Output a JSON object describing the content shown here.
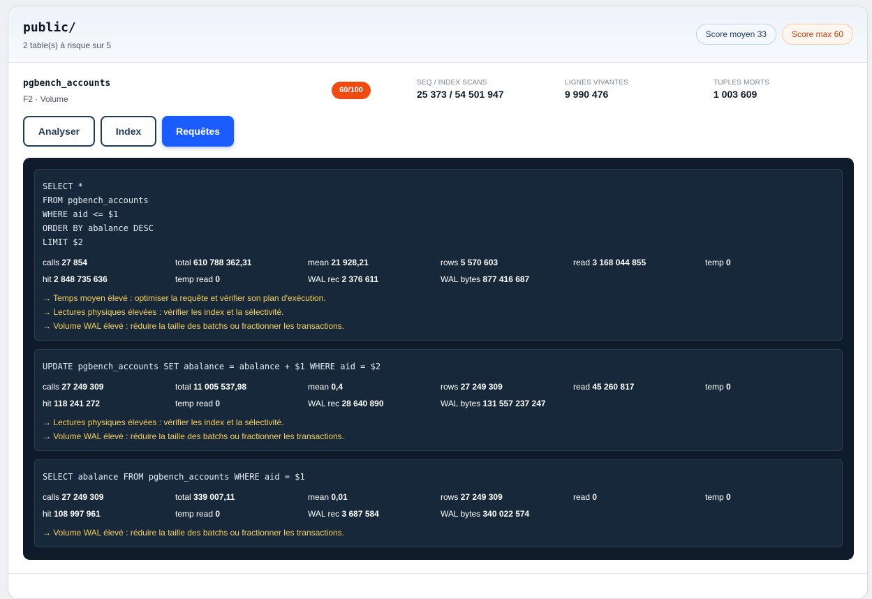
{
  "schema": {
    "title": "public/",
    "subtitle": "2 table(s) à risque sur 5"
  },
  "pills": {
    "avg": "Score moyen 33",
    "max": "Score max 60"
  },
  "table": {
    "name": "pgbench_accounts",
    "subtitle": "F2 · Volume",
    "score": "60/100",
    "stats": [
      {
        "label": "SEQ / INDEX SCANS",
        "value": "25 373 / 54 501 947"
      },
      {
        "label": "LIGNES VIVANTES",
        "value": "9 990 476"
      },
      {
        "label": "TUPLES MORTS",
        "value": "1 003 609"
      }
    ]
  },
  "buttons": {
    "analyze": "Analyser",
    "index": "Index",
    "queries": "Requêtes"
  },
  "queries": [
    {
      "sql": "SELECT *\nFROM pgbench_accounts\nWHERE aid <= $1\nORDER BY abalance DESC\nLIMIT $2",
      "metrics": [
        {
          "label": "calls",
          "value": "27 854"
        },
        {
          "label": "total",
          "value": "610 788 362,31"
        },
        {
          "label": "mean",
          "value": "21 928,21"
        },
        {
          "label": "rows",
          "value": "5 570 603"
        },
        {
          "label": "read",
          "value": "3 168 044 855"
        },
        {
          "label": "temp",
          "value": "0"
        },
        {
          "label": "hit",
          "value": "2 848 735 636"
        },
        {
          "label": "temp read",
          "value": "0"
        },
        {
          "label": "WAL rec",
          "value": "2 376 611"
        },
        {
          "label": "WAL bytes",
          "value": "877 416 687"
        }
      ],
      "hints": [
        "→ Temps moyen élevé : optimiser la requête et vérifier son plan d'exécution.",
        "→ Lectures physiques élevées : vérifier les index et la sélectivité.",
        "→ Volume WAL élevé : réduire la taille des batchs ou fractionner les transactions."
      ]
    },
    {
      "sql": "UPDATE pgbench_accounts SET abalance = abalance + $1 WHERE aid = $2",
      "metrics": [
        {
          "label": "calls",
          "value": "27 249 309"
        },
        {
          "label": "total",
          "value": "11 005 537,98"
        },
        {
          "label": "mean",
          "value": "0,4"
        },
        {
          "label": "rows",
          "value": "27 249 309"
        },
        {
          "label": "read",
          "value": "45 260 817"
        },
        {
          "label": "temp",
          "value": "0"
        },
        {
          "label": "hit",
          "value": "118 241 272"
        },
        {
          "label": "temp read",
          "value": "0"
        },
        {
          "label": "WAL rec",
          "value": "28 640 890"
        },
        {
          "label": "WAL bytes",
          "value": "131 557 237 247"
        }
      ],
      "hints": [
        "→ Lectures physiques élevées : vérifier les index et la sélectivité.",
        "→ Volume WAL élevé : réduire la taille des batchs ou fractionner les transactions."
      ]
    },
    {
      "sql": "SELECT abalance FROM pgbench_accounts WHERE aid = $1",
      "metrics": [
        {
          "label": "calls",
          "value": "27 249 309"
        },
        {
          "label": "total",
          "value": "339 007,11"
        },
        {
          "label": "mean",
          "value": "0,01"
        },
        {
          "label": "rows",
          "value": "27 249 309"
        },
        {
          "label": "read",
          "value": "0"
        },
        {
          "label": "temp",
          "value": "0"
        },
        {
          "label": "hit",
          "value": "108 997 961"
        },
        {
          "label": "temp read",
          "value": "0"
        },
        {
          "label": "WAL rec",
          "value": "3 687 584"
        },
        {
          "label": "WAL bytes",
          "value": "340 022 574"
        }
      ],
      "hints": [
        "→ Volume WAL élevé : réduire la taille des batchs ou fractionner les transactions."
      ]
    }
  ]
}
